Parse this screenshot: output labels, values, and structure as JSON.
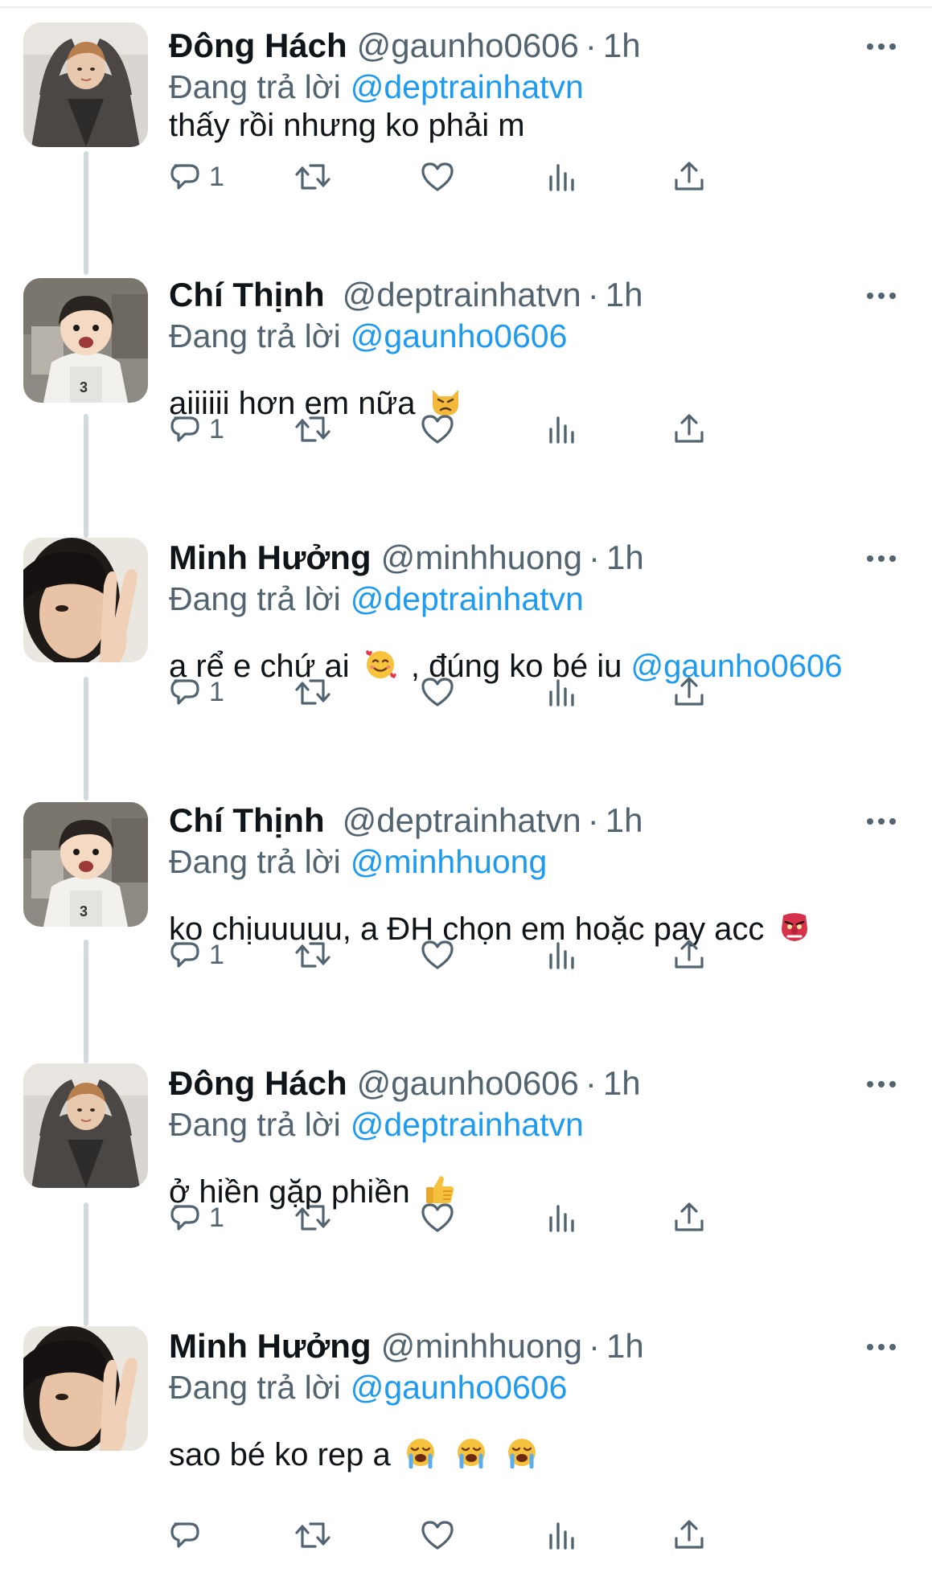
{
  "reply_prefix": "Đang trả lời",
  "tweets": [
    {
      "name": "Đông Hách",
      "handle": "@gaunho0606",
      "dot": "·",
      "time": "1h",
      "reply_to": "@deptrainhatvn",
      "text": "thấy rồi nhưng ko phải m",
      "reply_count": "1",
      "avatar": "avatar-dong-hach"
    },
    {
      "name": "Chí Thịnh",
      "handle": "@deptrainhatvn",
      "dot": "·",
      "time": "1h",
      "reply_to": "@gaunho0606",
      "text": "aiiiiii hơn em nữa",
      "emoji": "pouting-cat-emoji",
      "reply_count": "1",
      "avatar": "avatar-chi-thinh"
    },
    {
      "name": "Minh Hưởng",
      "handle": "@minhhuong",
      "dot": "·",
      "time": "1h",
      "reply_to": "@deptrainhatvn",
      "text_before": "a rể e chứ ai",
      "emoji": "smiling-face-with-hearts-emoji",
      "text_after": ", đúng ko bé iu",
      "text_mention": "@gaunho0606",
      "reply_count": "1",
      "avatar": "avatar-minh-huong"
    },
    {
      "name": "Chí Thịnh",
      "handle": "@deptrainhatvn",
      "dot": "·",
      "time": "1h",
      "reply_to": "@minhhuong",
      "text": "ko chịuuuuu, a ĐH chọn em hoặc pay acc",
      "emoji": "goblin-emoji",
      "reply_count": "1",
      "avatar": "avatar-chi-thinh"
    },
    {
      "name": "Đông Hách",
      "handle": "@gaunho0606",
      "dot": "·",
      "time": "1h",
      "reply_to": "@deptrainhatvn",
      "text": "ở hiền gặp phiền",
      "emoji": "thumbs-up-emoji",
      "reply_count": "1",
      "avatar": "avatar-dong-hach"
    },
    {
      "name": "Minh Hưởng",
      "handle": "@minhhuong",
      "dot": "·",
      "time": "1h",
      "reply_to": "@gaunho0606",
      "text": "sao bé ko rep a",
      "emoji": "loudly-crying-face-emoji",
      "emoji_count": 3,
      "avatar": "avatar-minh-huong"
    }
  ],
  "icons": {
    "reply": "reply-bubble-icon",
    "retweet": "retweet-icon",
    "like": "heart-icon",
    "views": "views-chart-icon",
    "share": "share-icon",
    "more": "more-dots-icon"
  },
  "colors": {
    "link": "#1d9bf0",
    "secondary_text": "#536471",
    "primary_text": "#0f1419",
    "thread_line": "#cfd9de"
  }
}
